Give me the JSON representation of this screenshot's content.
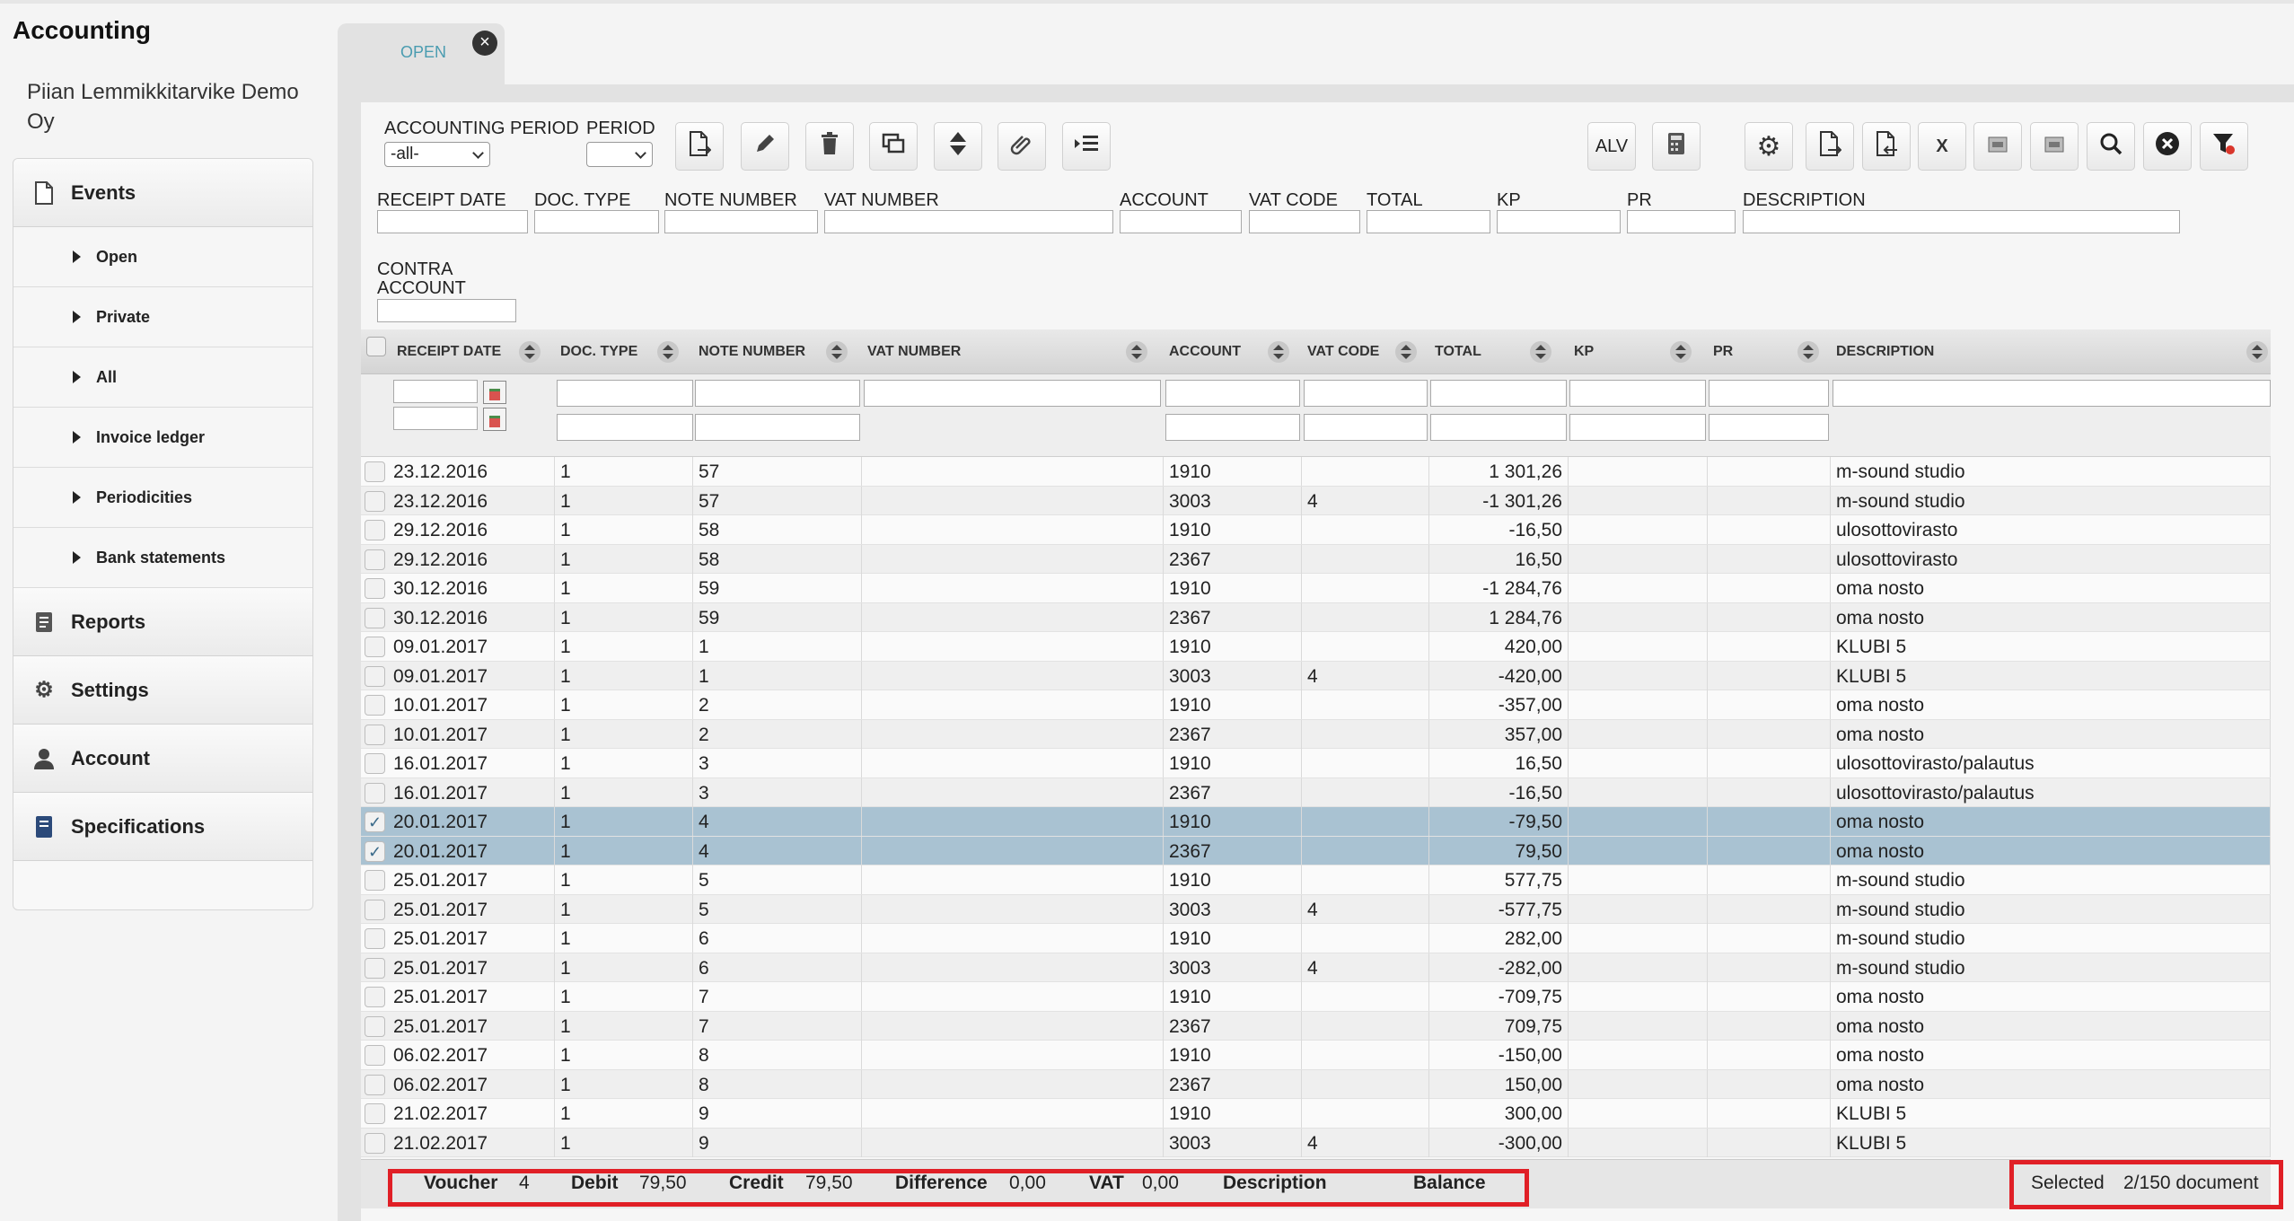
{
  "app": {
    "title": "Accounting",
    "company": "Piian Lemmikkitarvike Demo Oy"
  },
  "sidebar": {
    "events": "Events",
    "sub_items": [
      "Open",
      "Private",
      "All",
      "Invoice ledger",
      "Periodicities",
      "Bank statements"
    ],
    "reports": "Reports",
    "settings": "Settings",
    "account": "Account",
    "specifications": "Specifications"
  },
  "tab": {
    "label": "OPEN",
    "close": "×"
  },
  "toolbar": {
    "accounting_period_label": "ACCOUNTING PERIOD",
    "accounting_period_value": "-all-",
    "period_label": "PERIOD",
    "period_value": "",
    "alv_label": "ALV",
    "icons": {
      "new": "new-document-icon",
      "edit": "pencil-icon",
      "delete": "trash-icon",
      "copy": "copy-icon",
      "sort": "sort-updown-icon",
      "attach": "paperclip-icon",
      "list": "list-indent-icon",
      "calc": "calculator-icon",
      "settings": "gear-icon",
      "import": "import-document-icon",
      "export": "export-document-icon",
      "excel": "excel-icon",
      "form1": "form-icon",
      "form2": "form-icon",
      "search": "search-icon",
      "clear": "close-circle-icon",
      "filter_clear": "filter-remove-icon"
    }
  },
  "filters": {
    "receipt_date": "RECEIPT DATE",
    "doc_type": "DOC. TYPE",
    "note_number": "NOTE NUMBER",
    "vat_number": "VAT NUMBER",
    "account": "ACCOUNT",
    "vat_code": "VAT CODE",
    "total": "TOTAL",
    "kp": "KP",
    "pr": "PR",
    "description": "DESCRIPTION",
    "contra_account_1": "CONTRA",
    "contra_account_2": "ACCOUNT"
  },
  "grid": {
    "columns": [
      "RECEIPT DATE",
      "DOC. TYPE",
      "NOTE NUMBER",
      "VAT NUMBER",
      "ACCOUNT",
      "VAT CODE",
      "TOTAL",
      "KP",
      "PR",
      "DESCRIPTION"
    ],
    "rows": [
      {
        "date": "23.12.2016",
        "doc": "1",
        "note": "57",
        "vat_number": "",
        "account": "1910",
        "vat_code": "",
        "total": "1 301,26",
        "kp": "",
        "pr": "",
        "description": "m-sound studio",
        "selected": false
      },
      {
        "date": "23.12.2016",
        "doc": "1",
        "note": "57",
        "vat_number": "",
        "account": "3003",
        "vat_code": "4",
        "total": "-1 301,26",
        "kp": "",
        "pr": "",
        "description": "m-sound studio",
        "selected": false
      },
      {
        "date": "29.12.2016",
        "doc": "1",
        "note": "58",
        "vat_number": "",
        "account": "1910",
        "vat_code": "",
        "total": "-16,50",
        "kp": "",
        "pr": "",
        "description": "ulosottovirasto",
        "selected": false
      },
      {
        "date": "29.12.2016",
        "doc": "1",
        "note": "58",
        "vat_number": "",
        "account": "2367",
        "vat_code": "",
        "total": "16,50",
        "kp": "",
        "pr": "",
        "description": "ulosottovirasto",
        "selected": false
      },
      {
        "date": "30.12.2016",
        "doc": "1",
        "note": "59",
        "vat_number": "",
        "account": "1910",
        "vat_code": "",
        "total": "-1 284,76",
        "kp": "",
        "pr": "",
        "description": "oma nosto",
        "selected": false
      },
      {
        "date": "30.12.2016",
        "doc": "1",
        "note": "59",
        "vat_number": "",
        "account": "2367",
        "vat_code": "",
        "total": "1 284,76",
        "kp": "",
        "pr": "",
        "description": "oma nosto",
        "selected": false
      },
      {
        "date": "09.01.2017",
        "doc": "1",
        "note": "1",
        "vat_number": "",
        "account": "1910",
        "vat_code": "",
        "total": "420,00",
        "kp": "",
        "pr": "",
        "description": "KLUBI 5",
        "selected": false
      },
      {
        "date": "09.01.2017",
        "doc": "1",
        "note": "1",
        "vat_number": "",
        "account": "3003",
        "vat_code": "4",
        "total": "-420,00",
        "kp": "",
        "pr": "",
        "description": "KLUBI 5",
        "selected": false
      },
      {
        "date": "10.01.2017",
        "doc": "1",
        "note": "2",
        "vat_number": "",
        "account": "1910",
        "vat_code": "",
        "total": "-357,00",
        "kp": "",
        "pr": "",
        "description": "oma nosto",
        "selected": false
      },
      {
        "date": "10.01.2017",
        "doc": "1",
        "note": "2",
        "vat_number": "",
        "account": "2367",
        "vat_code": "",
        "total": "357,00",
        "kp": "",
        "pr": "",
        "description": "oma nosto",
        "selected": false
      },
      {
        "date": "16.01.2017",
        "doc": "1",
        "note": "3",
        "vat_number": "",
        "account": "1910",
        "vat_code": "",
        "total": "16,50",
        "kp": "",
        "pr": "",
        "description": "ulosottovirasto/palautus",
        "selected": false
      },
      {
        "date": "16.01.2017",
        "doc": "1",
        "note": "3",
        "vat_number": "",
        "account": "2367",
        "vat_code": "",
        "total": "-16,50",
        "kp": "",
        "pr": "",
        "description": "ulosottovirasto/palautus",
        "selected": false
      },
      {
        "date": "20.01.2017",
        "doc": "1",
        "note": "4",
        "vat_number": "",
        "account": "1910",
        "vat_code": "",
        "total": "-79,50",
        "kp": "",
        "pr": "",
        "description": "oma nosto",
        "selected": true
      },
      {
        "date": "20.01.2017",
        "doc": "1",
        "note": "4",
        "vat_number": "",
        "account": "2367",
        "vat_code": "",
        "total": "79,50",
        "kp": "",
        "pr": "",
        "description": "oma nosto",
        "selected": true
      },
      {
        "date": "25.01.2017",
        "doc": "1",
        "note": "5",
        "vat_number": "",
        "account": "1910",
        "vat_code": "",
        "total": "577,75",
        "kp": "",
        "pr": "",
        "description": "m-sound studio",
        "selected": false
      },
      {
        "date": "25.01.2017",
        "doc": "1",
        "note": "5",
        "vat_number": "",
        "account": "3003",
        "vat_code": "4",
        "total": "-577,75",
        "kp": "",
        "pr": "",
        "description": "m-sound studio",
        "selected": false
      },
      {
        "date": "25.01.2017",
        "doc": "1",
        "note": "6",
        "vat_number": "",
        "account": "1910",
        "vat_code": "",
        "total": "282,00",
        "kp": "",
        "pr": "",
        "description": "m-sound studio",
        "selected": false
      },
      {
        "date": "25.01.2017",
        "doc": "1",
        "note": "6",
        "vat_number": "",
        "account": "3003",
        "vat_code": "4",
        "total": "-282,00",
        "kp": "",
        "pr": "",
        "description": "m-sound studio",
        "selected": false
      },
      {
        "date": "25.01.2017",
        "doc": "1",
        "note": "7",
        "vat_number": "",
        "account": "1910",
        "vat_code": "",
        "total": "-709,75",
        "kp": "",
        "pr": "",
        "description": "oma nosto",
        "selected": false
      },
      {
        "date": "25.01.2017",
        "doc": "1",
        "note": "7",
        "vat_number": "",
        "account": "2367",
        "vat_code": "",
        "total": "709,75",
        "kp": "",
        "pr": "",
        "description": "oma nosto",
        "selected": false
      },
      {
        "date": "06.02.2017",
        "doc": "1",
        "note": "8",
        "vat_number": "",
        "account": "1910",
        "vat_code": "",
        "total": "-150,00",
        "kp": "",
        "pr": "",
        "description": "oma nosto",
        "selected": false
      },
      {
        "date": "06.02.2017",
        "doc": "1",
        "note": "8",
        "vat_number": "",
        "account": "2367",
        "vat_code": "",
        "total": "150,00",
        "kp": "",
        "pr": "",
        "description": "oma nosto",
        "selected": false
      },
      {
        "date": "21.02.2017",
        "doc": "1",
        "note": "9",
        "vat_number": "",
        "account": "1910",
        "vat_code": "",
        "total": "300,00",
        "kp": "",
        "pr": "",
        "description": "KLUBI 5",
        "selected": false
      },
      {
        "date": "21.02.2017",
        "doc": "1",
        "note": "9",
        "vat_number": "",
        "account": "3003",
        "vat_code": "4",
        "total": "-300,00",
        "kp": "",
        "pr": "",
        "description": "KLUBI 5",
        "selected": false
      }
    ]
  },
  "footer": {
    "voucher_label": "Voucher",
    "voucher_value": "4",
    "debit_label": "Debit",
    "debit_value": "79,50",
    "credit_label": "Credit",
    "credit_value": "79,50",
    "difference_label": "Difference",
    "difference_value": "0,00",
    "vat_label": "VAT",
    "vat_value": "0,00",
    "description_label": "Description",
    "balance_label": "Balance",
    "selected_label": "Selected",
    "selected_value": "2/150 document"
  },
  "colors": {
    "selected_row": "#a9c2d2",
    "highlight_box": "#e01f26",
    "tab_text": "#4a9cb0"
  }
}
